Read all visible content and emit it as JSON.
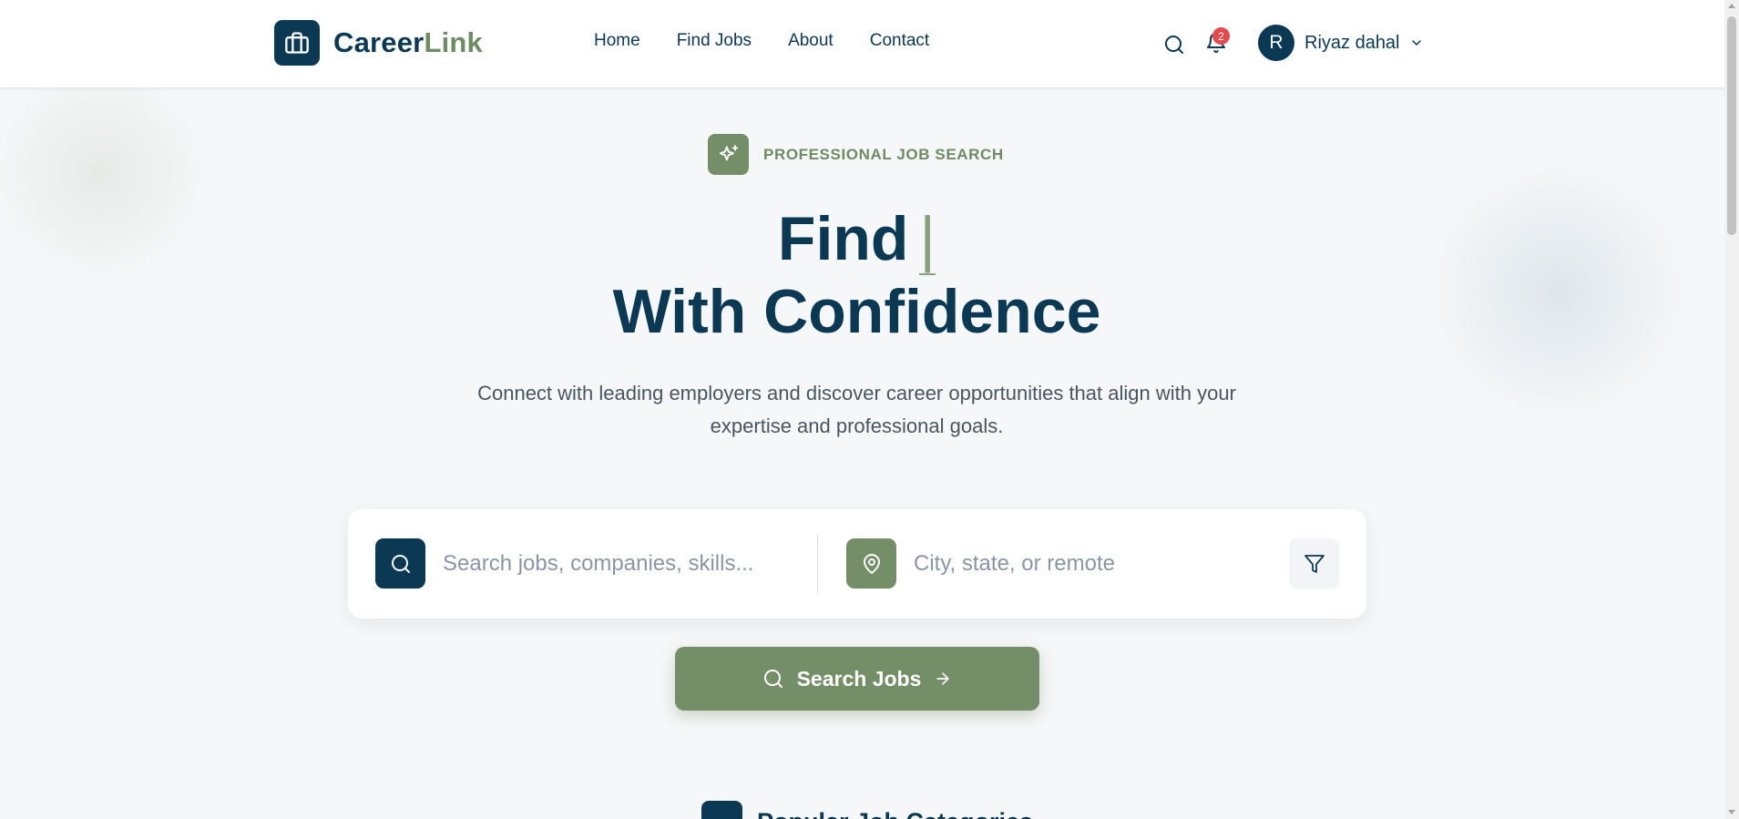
{
  "brand": {
    "name_part1": "Career",
    "name_part2": "Link",
    "icon": "briefcase-icon"
  },
  "nav": {
    "items": [
      "Home",
      "Find Jobs",
      "About",
      "Contact"
    ]
  },
  "header": {
    "notification_count": "2",
    "user_initial": "R",
    "user_name": "Riyaz dahal"
  },
  "hero": {
    "tagline": "PROFESSIONAL JOB SEARCH",
    "tagline_icon": "sparkles-icon",
    "title_line1": "Find",
    "typing_cursor": "|",
    "title_line2": "With Confidence",
    "subtitle": "Connect with leading employers and discover career opportunities that align with your expertise and professional goals."
  },
  "search": {
    "keyword_placeholder": "Search jobs, companies, skills...",
    "location_placeholder": "City, state, or remote",
    "button_label": "Search Jobs"
  },
  "categories": {
    "title": "Popular Job Categories"
  },
  "colors": {
    "primary": "#0b3954",
    "accent": "#748f68",
    "badge": "#e5484d"
  }
}
